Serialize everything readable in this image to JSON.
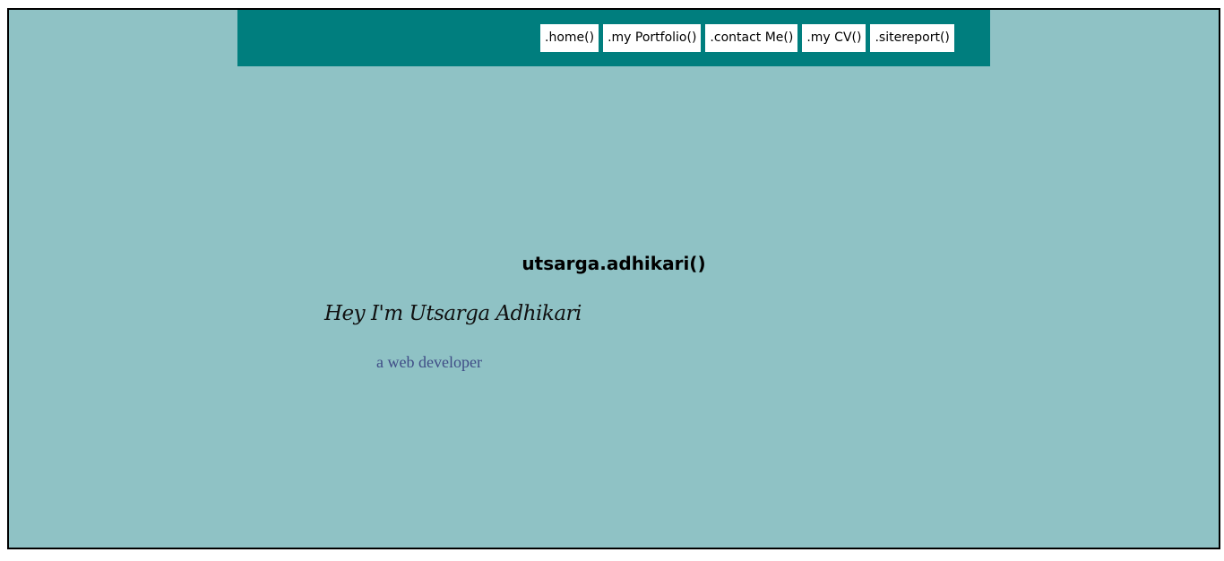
{
  "nav": {
    "items": [
      {
        "label": ".home()"
      },
      {
        "label": ".my Portfolio()"
      },
      {
        "label": ".contact Me()"
      },
      {
        "label": ".my CV()"
      },
      {
        "label": ".sitereport()"
      }
    ]
  },
  "hero": {
    "title": "utsarga.adhikari()",
    "greeting": "Hey I'm Utsarga Adhikari",
    "role": "a web developer"
  },
  "colors": {
    "page_background": "#8fc2c5",
    "navbar_background": "#007e7e",
    "nav_item_background": "#ffffff",
    "role_text": "#3f4c86"
  }
}
